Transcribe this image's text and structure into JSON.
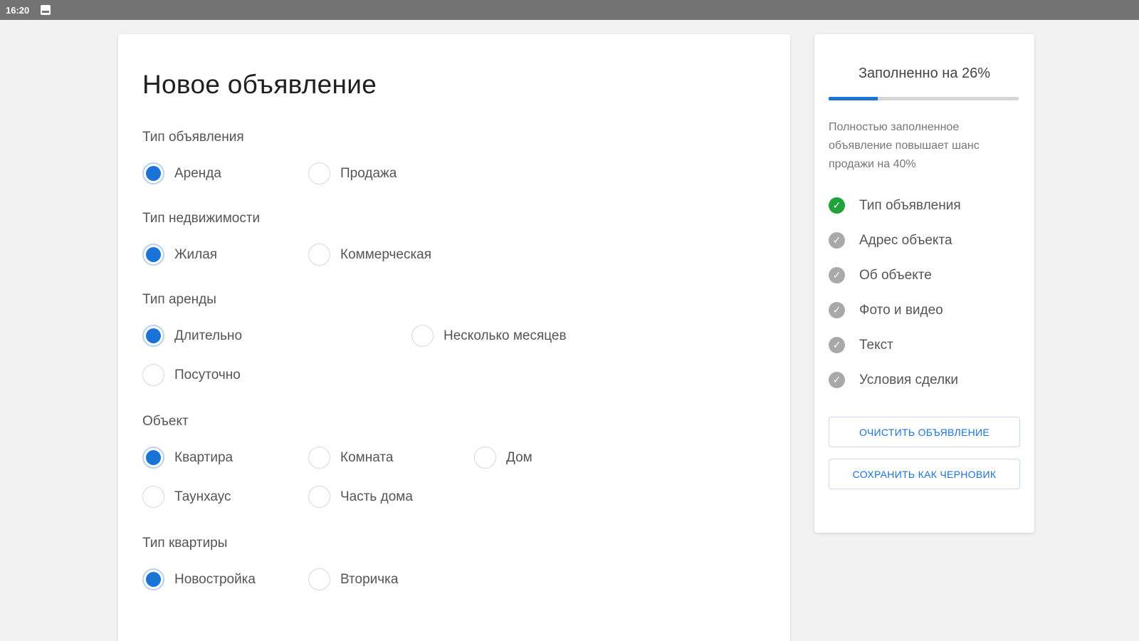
{
  "status_bar": {
    "time": "16:20",
    "icon": "image-icon"
  },
  "form": {
    "title": "Новое объявление",
    "sections": [
      {
        "label": "Тип объявления",
        "options": [
          {
            "label": "Аренда",
            "selected": true
          },
          {
            "label": "Продажа",
            "selected": false
          }
        ]
      },
      {
        "label": "Тип недвижимости",
        "options": [
          {
            "label": "Жилая",
            "selected": true
          },
          {
            "label": "Коммерческая",
            "selected": false
          }
        ]
      },
      {
        "label": "Тип аренды",
        "options": [
          {
            "label": "Длительно",
            "selected": true
          },
          {
            "label": "Несколько месяцев",
            "selected": false
          },
          {
            "label": "Посуточно",
            "selected": false
          }
        ]
      },
      {
        "label": "Объект",
        "options": [
          {
            "label": "Квартира",
            "selected": true
          },
          {
            "label": "Комната",
            "selected": false
          },
          {
            "label": "Дом",
            "selected": false
          },
          {
            "label": "Таунхаус",
            "selected": false
          },
          {
            "label": "Часть дома",
            "selected": false
          }
        ]
      },
      {
        "label": "Тип квартиры",
        "options": [
          {
            "label": "Новостройка",
            "selected": true
          },
          {
            "label": "Вторичка",
            "selected": false
          }
        ]
      }
    ]
  },
  "progress": {
    "title": "Заполненно на 26%",
    "percent": 26,
    "hint": "Полностью заполненное объявление повышает шанс продажи на 40%",
    "steps": [
      {
        "label": "Тип объявления",
        "done": true
      },
      {
        "label": "Адрес объекта",
        "done": false
      },
      {
        "label": "Об объекте",
        "done": false
      },
      {
        "label": "Фото и видео",
        "done": false
      },
      {
        "label": "Текст",
        "done": false
      },
      {
        "label": "Условия сделки",
        "done": false
      }
    ],
    "clear_button": "очистить объявление",
    "save_button": "сохранить как черновик"
  },
  "colors": {
    "accent": "#1a73d6",
    "done": "#21a33a",
    "pending": "#a9a9a9"
  }
}
